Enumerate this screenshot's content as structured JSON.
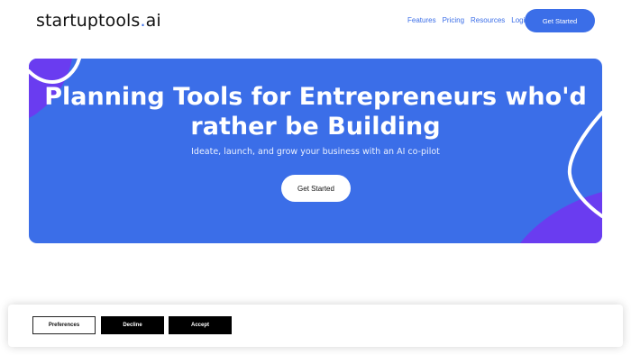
{
  "brand": {
    "name": "startuptools",
    "dot": ".",
    "tld": "ai",
    "accent": "#3b6ee8"
  },
  "nav": {
    "items": [
      {
        "label": "Features"
      },
      {
        "label": "Pricing"
      },
      {
        "label": "Resources"
      },
      {
        "label": "Login"
      }
    ],
    "cta_label": "Get Started"
  },
  "hero": {
    "title": "Planning Tools for Entrepreneurs who'd rather be Building",
    "subtitle": "Ideate, launch, and grow your business with an AI co-pilot",
    "cta_label": "Get Started",
    "background": "#3b6ee8",
    "shape_color": "#6a3cf0"
  },
  "cookie_banner": {
    "preferences_label": "Preferences",
    "decline_label": "Decline",
    "accept_label": "Accept"
  }
}
